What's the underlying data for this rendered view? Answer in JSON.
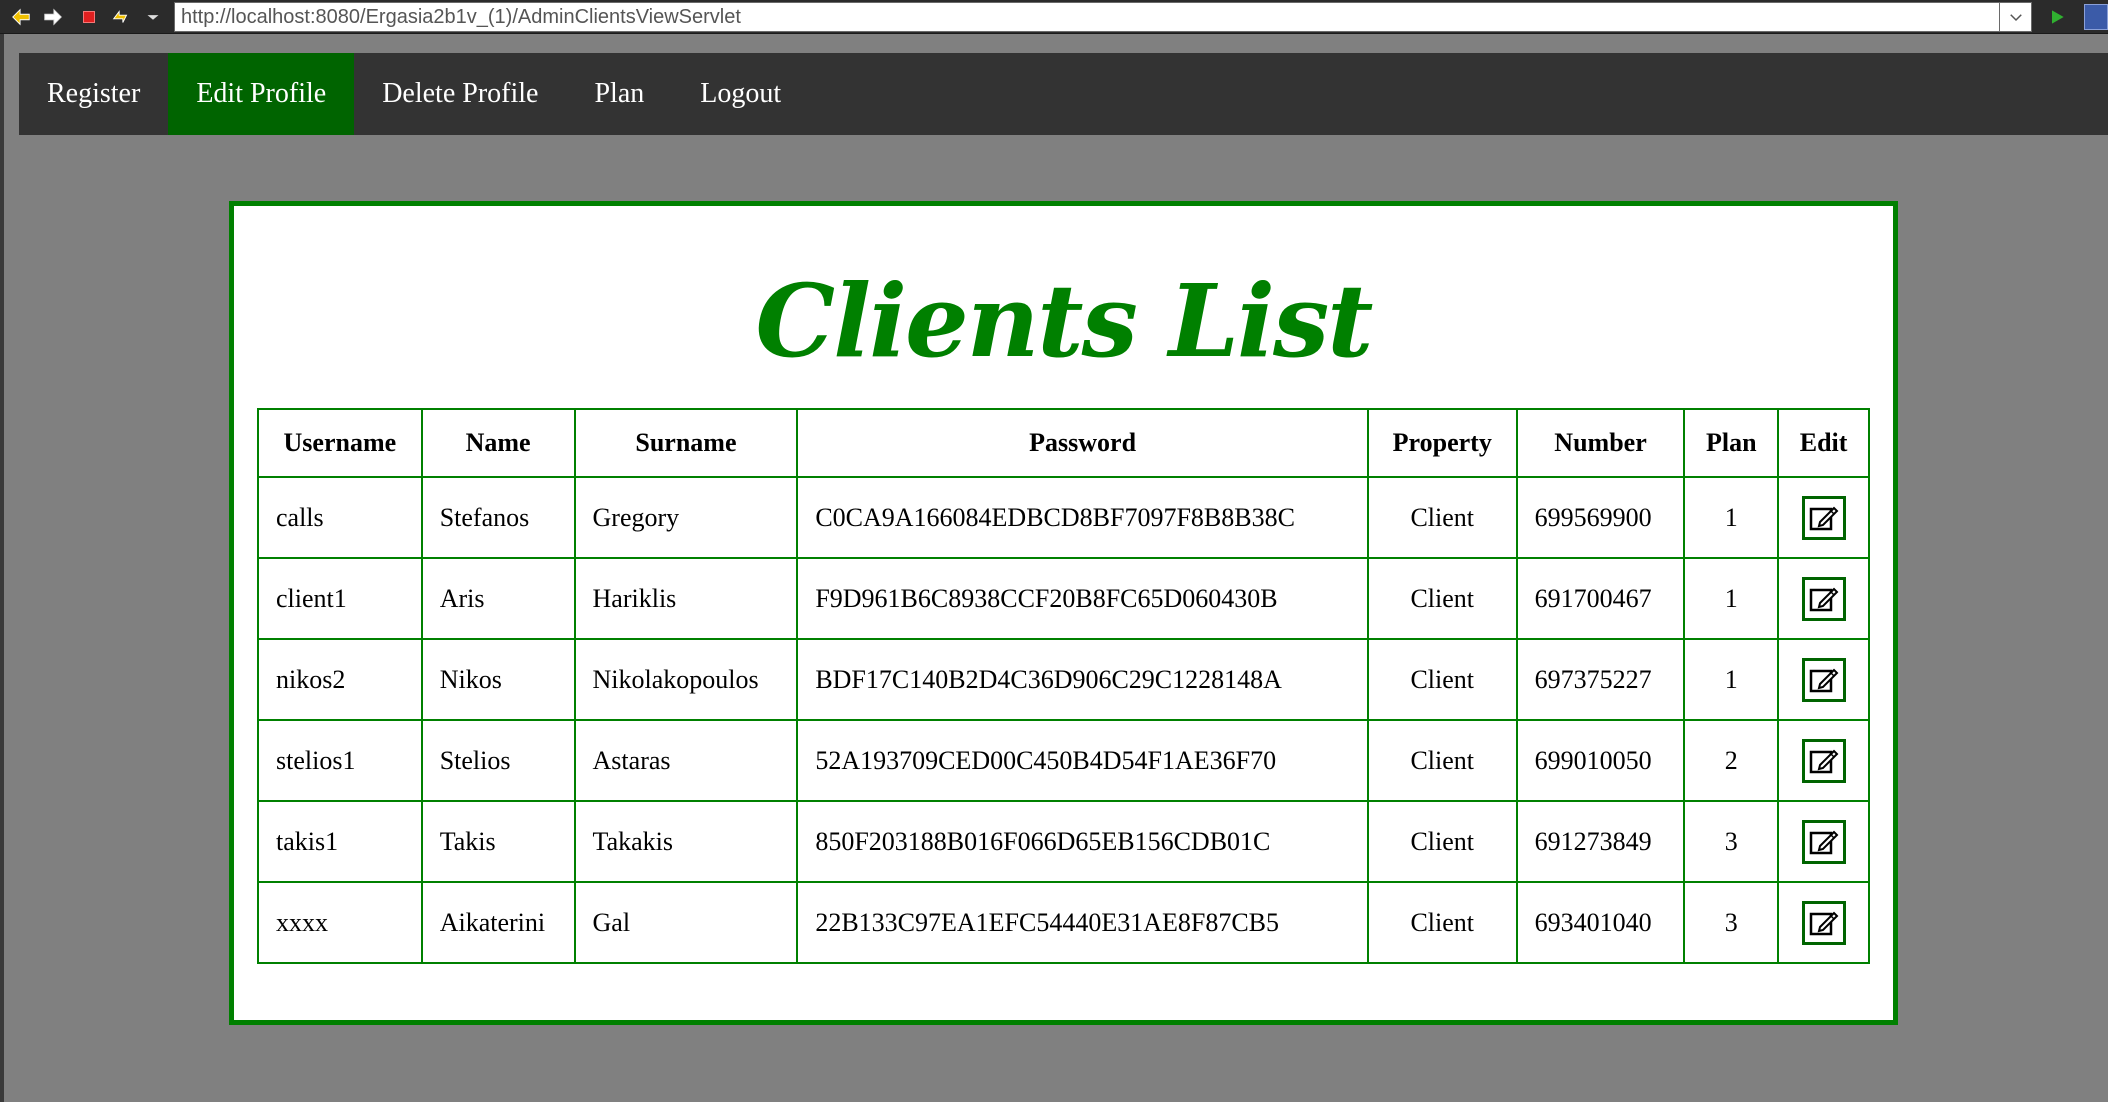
{
  "browser": {
    "url": "http://localhost:8080/Ergasia2b1v_(1)/AdminClientsViewServlet",
    "icons": [
      "back-arrow-icon",
      "forward-arrow-icon",
      "stop-icon",
      "refresh-icon",
      "chevron-down-icon",
      "go-play-icon"
    ]
  },
  "menu": {
    "items": [
      {
        "label": "Register"
      },
      {
        "label": "Edit Profile"
      },
      {
        "label": "Delete Profile"
      },
      {
        "label": "Plan"
      },
      {
        "label": "Logout"
      }
    ],
    "active_index": 1
  },
  "page": {
    "title": "Clients List"
  },
  "table": {
    "headers": [
      "Username",
      "Name",
      "Surname",
      "Password",
      "Property",
      "Number",
      "Plan",
      "Edit"
    ],
    "rows": [
      {
        "username": "calls",
        "name": "Stefanos",
        "surname": "Gregory",
        "password": "C0CA9A166084EDBCD8BF7097F8B8B38C",
        "property": "Client",
        "number": "699569900",
        "plan": "1"
      },
      {
        "username": "client1",
        "name": "Aris",
        "surname": "Hariklis",
        "password": "F9D961B6C8938CCF20B8FC65D060430B",
        "property": "Client",
        "number": "691700467",
        "plan": "1"
      },
      {
        "username": "nikos2",
        "name": "Nikos",
        "surname": "Nikolakopoulos",
        "password": "BDF17C140B2D4C36D906C29C1228148A",
        "property": "Client",
        "number": "697375227",
        "plan": "1"
      },
      {
        "username": "stelios1",
        "name": "Stelios",
        "surname": "Astaras",
        "password": "52A193709CED00C450B4D54F1AE36F70",
        "property": "Client",
        "number": "699010050",
        "plan": "2"
      },
      {
        "username": "takis1",
        "name": "Takis",
        "surname": "Takakis",
        "password": "850F203188B016F066D65EB156CDB01C",
        "property": "Client",
        "number": "691273849",
        "plan": "3"
      },
      {
        "username": "xxxx",
        "name": "Aikaterini",
        "surname": "Gal",
        "password": "22B133C97EA1EFC54440E31AE8F87CB5",
        "property": "Client",
        "number": "693401040",
        "plan": "3"
      }
    ]
  },
  "colors": {
    "accent": "#008000",
    "active_menu": "#006400",
    "menu_bg": "#333333",
    "page_bg": "#808080"
  }
}
